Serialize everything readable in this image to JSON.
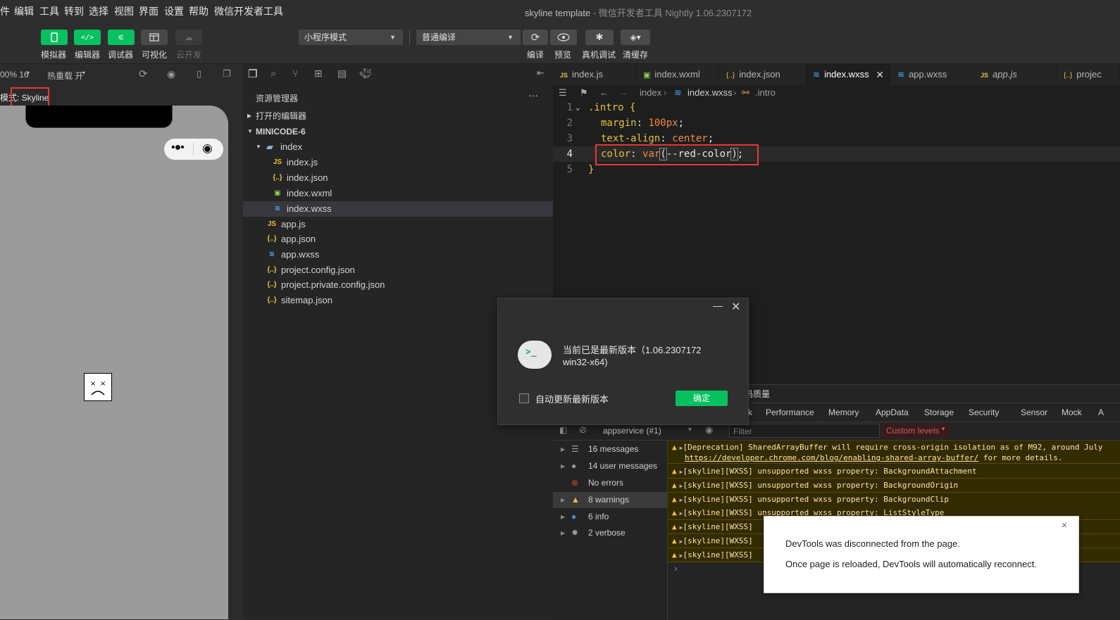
{
  "menubar": {
    "items": [
      "件",
      "编辑",
      "工具",
      "转到",
      "选择",
      "视图",
      "界面",
      "设置",
      "帮助",
      "微信开发者工具"
    ],
    "title": "skyline template",
    "title_sub": " - 微信开发者工具 Nightly 1.06.2307172"
  },
  "toolbar": {
    "buttons": [
      {
        "label": "模拟器",
        "icon": "phone-icon",
        "active": true
      },
      {
        "label": "编辑器",
        "icon": "code-icon",
        "active": true
      },
      {
        "label": "调试器",
        "icon": "debug-icon",
        "active": true
      },
      {
        "label": "可视化",
        "icon": "layout-icon",
        "active": false
      },
      {
        "label": "云开发",
        "icon": "cloud-icon",
        "active": false
      }
    ],
    "mode_select": "小程序模式",
    "compile_select": "普通编译",
    "actions": [
      {
        "label": "编译",
        "icon": "refresh-icon"
      },
      {
        "label": "预览",
        "icon": "eye-icon"
      },
      {
        "label": "真机调试",
        "icon": "bug-icon"
      },
      {
        "label": "清缓存",
        "icon": "layers-icon"
      }
    ]
  },
  "simulator": {
    "zoom": "00% 16",
    "hot_reload": "热重载 开",
    "render_mode": "模式: Skyline"
  },
  "explorer": {
    "title": "资源管理器",
    "more": "···",
    "open_editors": "打开的编辑器",
    "project": "MINICODE-6",
    "folder": "index",
    "folder_files": [
      {
        "name": "index.js",
        "type": "js"
      },
      {
        "name": "index.json",
        "type": "json"
      },
      {
        "name": "index.wxml",
        "type": "wxml"
      },
      {
        "name": "index.wxss",
        "type": "wxss"
      }
    ],
    "root_files": [
      {
        "name": "app.js",
        "type": "js"
      },
      {
        "name": "app.json",
        "type": "json"
      },
      {
        "name": "app.wxss",
        "type": "wxss"
      },
      {
        "name": "project.config.json",
        "type": "json"
      },
      {
        "name": "project.private.config.json",
        "type": "json"
      },
      {
        "name": "sitemap.json",
        "type": "json"
      }
    ]
  },
  "editor": {
    "tabs": [
      {
        "name": "index.js",
        "type": "js"
      },
      {
        "name": "index.wxml",
        "type": "wxml"
      },
      {
        "name": "index.json",
        "type": "json"
      },
      {
        "name": "index.wxss",
        "type": "wxss",
        "active": true
      },
      {
        "name": "app.wxss",
        "type": "wxss"
      },
      {
        "name": "app.js",
        "type": "js"
      },
      {
        "name": "projec",
        "type": "json"
      }
    ],
    "breadcrumb": [
      "index",
      "index.wxss",
      ".intro"
    ],
    "lines": [
      {
        "n": "1",
        "selector": ".intro",
        "brace": " {"
      },
      {
        "n": "2",
        "prop": "margin",
        "value": "100px"
      },
      {
        "n": "3",
        "prop": "text-align",
        "value": "center"
      },
      {
        "n": "4",
        "prop": "color",
        "fn": "var",
        "arg": "--red-color"
      },
      {
        "n": "5",
        "close": "}"
      }
    ]
  },
  "devtools": {
    "header_text": "码质量",
    "tabs": [
      "k",
      "Performance",
      "Memory",
      "AppData",
      "Storage",
      "Security",
      "Sensor",
      "Mock",
      "A"
    ],
    "context": "appservice (#1)",
    "filter_placeholder": "Filter",
    "levels": "Custom levels",
    "sidebar": [
      {
        "label": "16 messages",
        "icon": "list-icon"
      },
      {
        "label": "14 user messages",
        "icon": "user-icon"
      },
      {
        "label": "No errors",
        "icon": "error-icon"
      },
      {
        "label": "8 warnings",
        "icon": "warning-icon"
      },
      {
        "label": "6 info",
        "icon": "info-icon"
      },
      {
        "label": "2 verbose",
        "icon": "verbose-icon"
      }
    ],
    "logs": [
      "[Deprecation] SharedArrayBuffer will require cross-origin isolation as of M92, around July",
      "https://developer.chrome.com/blog/enabling-shared-array-buffer/",
      " for more details.",
      "[skyline][WXSS] unsupported wxss property: BackgroundAttachment",
      "[skyline][WXSS] unsupported wxss property: BackgroundOrigin",
      "[skyline][WXSS] unsupported wxss property: BackgroundClip",
      "[skyline][WXSS] unsupported wxss property: ListStyleType",
      "[skyline][WXSS]",
      "[skyline][WXSS]",
      "[skyline][WXSS]"
    ],
    "prompt": "›"
  },
  "dialog": {
    "message_line1": "当前已是最新版本（1.06.2307172",
    "message_line2": "win32-x64)",
    "checkbox_label": "自动更新最新版本",
    "confirm": "确定"
  },
  "toast": {
    "line1": "DevTools was disconnected from the page.",
    "line2": "Once page is reloaded, DevTools will automatically reconnect.",
    "close": "×"
  },
  "colors": {
    "accent": "#07c160",
    "highlight": "#e53935",
    "warning": "#f5c045"
  }
}
